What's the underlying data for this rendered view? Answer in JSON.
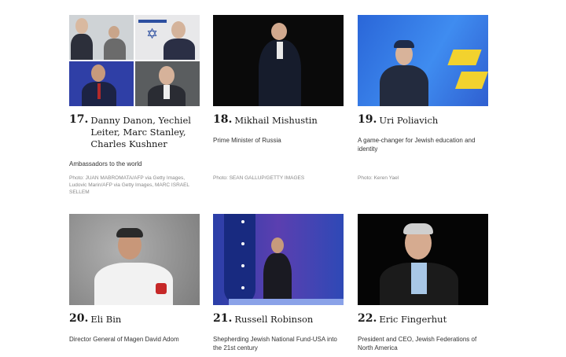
{
  "cards": [
    {
      "number": "17.",
      "names": "Danny Danon, Yechiel Leiter, Marc Stanley, Charles Kushner",
      "description": "Ambassadors to the world",
      "credit": "Photo: JUAN MABROMATA/AFP via Getty Images, Ludovic Marin/AFP via Getty Images, MARC ISRAEL SELLEM"
    },
    {
      "number": "18.",
      "names": "Mikhail Mishustin",
      "description": "Prime Minister of Russia",
      "credit": "Photo: SEAN GALLUP/GETTY IMAGES"
    },
    {
      "number": "19.",
      "names": "Uri Poliavich",
      "description": "A game-changer for Jewish education and identity",
      "credit": "Photo: Keren Yael"
    },
    {
      "number": "20.",
      "names": "Eli Bin",
      "description": "Director General of Magen David Adom",
      "credit": ""
    },
    {
      "number": "21.",
      "names": "Russell Robinson",
      "description": "Shepherding Jewish National Fund-USA into the 21st century",
      "credit": ""
    },
    {
      "number": "22.",
      "names": "Eric Fingerhut",
      "description": "President and CEO, Jewish Federations of North America",
      "credit": ""
    }
  ]
}
